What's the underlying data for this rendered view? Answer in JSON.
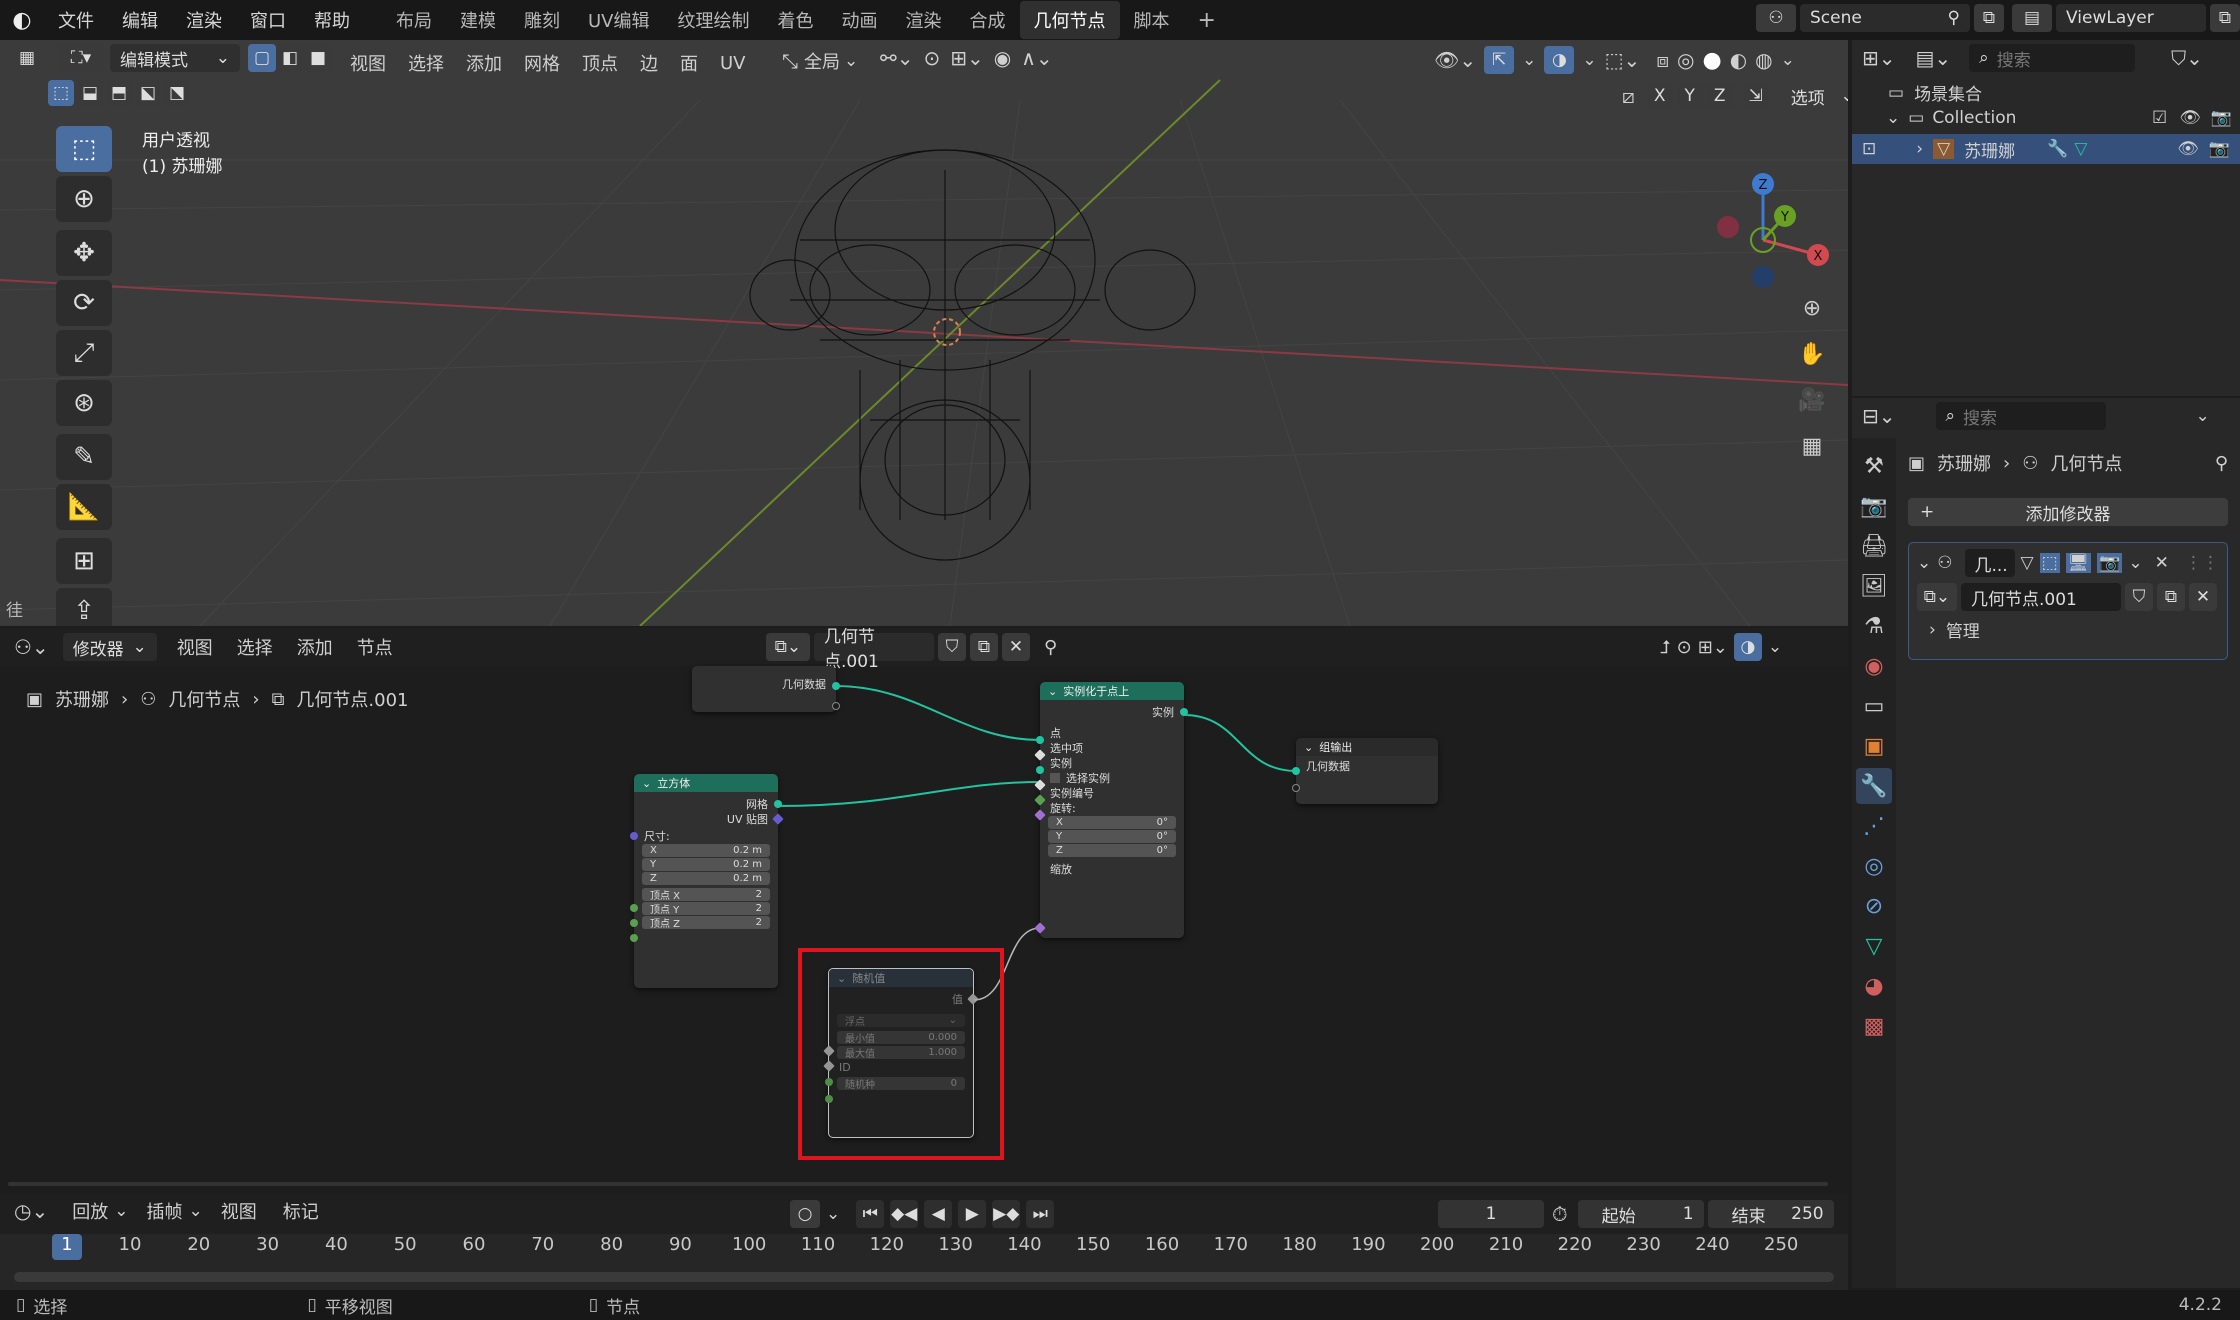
{
  "menu": [
    "文件",
    "编辑",
    "渲染",
    "窗口",
    "帮助"
  ],
  "workspaces": [
    {
      "label": "布局",
      "active": false
    },
    {
      "label": "建模",
      "active": false
    },
    {
      "label": "雕刻",
      "active": false
    },
    {
      "label": "UV编辑",
      "active": false
    },
    {
      "label": "纹理绘制",
      "active": false
    },
    {
      "label": "着色",
      "active": false
    },
    {
      "label": "动画",
      "active": false
    },
    {
      "label": "渲染",
      "active": false
    },
    {
      "label": "合成",
      "active": false
    },
    {
      "label": "几何节点",
      "active": true
    },
    {
      "label": "脚本",
      "active": false
    }
  ],
  "scene_name": "Scene",
  "view_layer": "ViewLayer",
  "viewport": {
    "mode": "编辑模式",
    "menus": [
      "视图",
      "选择",
      "添加",
      "网格",
      "顶点",
      "边",
      "面",
      "UV"
    ],
    "transform": "全局",
    "overlay_title": "用户透视",
    "overlay_object": "(1) 苏珊娜",
    "axes": [
      "X",
      "Y",
      "Z"
    ],
    "options": "选项",
    "gizmo": {
      "z": "Z",
      "y": "Y",
      "x": "X"
    },
    "left_cut_label": "徍"
  },
  "outliner": {
    "search_placeholder": "搜索",
    "root": "场景集合",
    "collection": "Collection",
    "object": "苏珊娜"
  },
  "properties": {
    "search_placeholder": "搜索",
    "breadcrumb_object": "苏珊娜",
    "breadcrumb_modifier": "几何节点",
    "add_modifier": "添加修改器",
    "modifier_short": "几...",
    "node_group": "几何节点.001",
    "manage": "管理"
  },
  "node_editor": {
    "editor_type": "修改器",
    "menus": [
      "视图",
      "选择",
      "添加",
      "节点"
    ],
    "node_group": "几何节点.001",
    "breadcrumb": [
      "苏珊娜",
      "几何节点",
      "几何节点.001"
    ],
    "nodes": {
      "input": {
        "output": "几何数据"
      },
      "instance_on_points": {
        "title": "实例化于点上",
        "out": "实例",
        "inputs": [
          "点",
          "选中项",
          "实例",
          "选择实例",
          "实例编号",
          "旋转:"
        ],
        "rot": [
          {
            "axis": "X",
            "value": "0°"
          },
          {
            "axis": "Y",
            "value": "0°"
          },
          {
            "axis": "Z",
            "value": "0°"
          }
        ],
        "scale": "缩放"
      },
      "group_output": {
        "title": "组输出",
        "input": "几何数据"
      },
      "cube": {
        "title": "立方体",
        "outputs": [
          "网格",
          "UV 贴图"
        ],
        "size_label": "尺寸:",
        "size": [
          {
            "axis": "X",
            "value": "0.2 m"
          },
          {
            "axis": "Y",
            "value": "0.2 m"
          },
          {
            "axis": "Z",
            "value": "0.2 m"
          }
        ],
        "verts": [
          {
            "label": "顶点 X",
            "value": "2"
          },
          {
            "label": "顶点 Y",
            "value": "2"
          },
          {
            "label": "顶点 Z",
            "value": "2"
          }
        ]
      },
      "random_value": {
        "title": "随机值",
        "out": "值",
        "type": "浮点",
        "min_label": "最小值",
        "min": "0.000",
        "max_label": "最大值",
        "max": "1.000",
        "id": "ID",
        "seed_label": "随机种",
        "seed": "0"
      }
    }
  },
  "timeline": {
    "menus": [
      "回放",
      "插帧",
      "视图",
      "标记"
    ],
    "current_frame": "1",
    "start_label": "起始",
    "start": "1",
    "end_label": "结束",
    "end": "250",
    "ticks": [
      "1",
      "10",
      "20",
      "30",
      "40",
      "50",
      "60",
      "70",
      "80",
      "90",
      "100",
      "110",
      "120",
      "130",
      "140",
      "150",
      "160",
      "170",
      "180",
      "190",
      "200",
      "210",
      "220",
      "230",
      "240",
      "250"
    ]
  },
  "statusbar": {
    "select": "选择",
    "pan": "平移视图",
    "node": "节点",
    "version": "4.2.2"
  },
  "colors": {
    "accent": "#4a6ea0",
    "highlight_box": "#e0141e",
    "node_geo": "#1d6e5a",
    "node_input": "#6b3a3a"
  }
}
